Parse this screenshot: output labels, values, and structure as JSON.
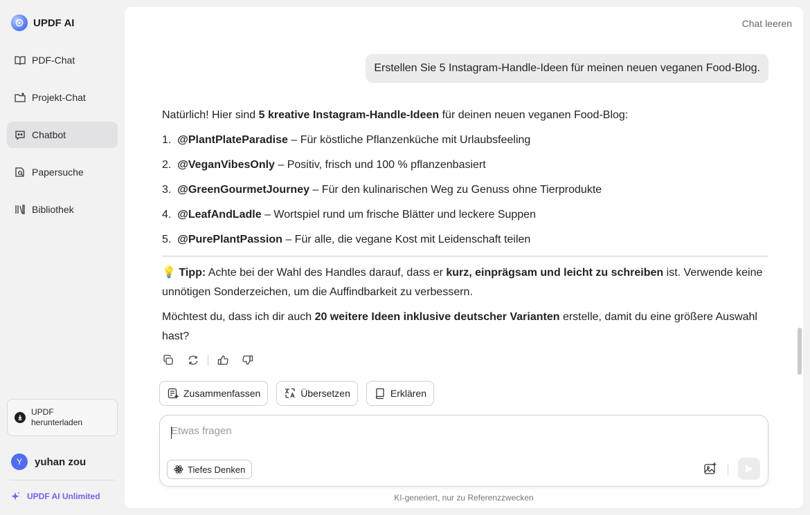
{
  "brand": {
    "name": "UPDF AI"
  },
  "sidebar": {
    "items": [
      {
        "label": "PDF-Chat",
        "icon": "book-open-icon"
      },
      {
        "label": "Projekt-Chat",
        "icon": "folder-plus-icon"
      },
      {
        "label": "Chatbot",
        "icon": "chatbot-icon",
        "active": true
      },
      {
        "label": "Papersuche",
        "icon": "paper-search-icon"
      },
      {
        "label": "Bibliothek",
        "icon": "library-icon"
      }
    ],
    "download": {
      "line1": "UPDF",
      "line2": "herunterladen"
    },
    "user": {
      "initial": "Y",
      "name": "yuhan zou"
    },
    "unlimited": "UPDF AI Unlimited"
  },
  "header": {
    "clear_chat": "Chat leeren"
  },
  "conversation": {
    "user_message": "Erstellen Sie 5 Instagram-Handle-Ideen für meinen neuen veganen Food-Blog.",
    "intro_pre": "Natürlich! Hier sind ",
    "intro_bold": "5 kreative Instagram-Handle-Ideen",
    "intro_post": " für deinen neuen veganen Food-Blog:",
    "list": [
      {
        "num": "1.",
        "handle": "@PlantPlateParadise",
        "desc": " – Für köstliche Pflanzenküche mit Urlaubsfeeling"
      },
      {
        "num": "2.",
        "handle": "@VeganVibesOnly",
        "desc": " – Positiv, frisch und 100 % pflanzenbasiert"
      },
      {
        "num": "3.",
        "handle": "@GreenGourmetJourney",
        "desc": " – Für den kulinarischen Weg zu Genuss ohne Tierprodukte"
      },
      {
        "num": "4.",
        "handle": "@LeafAndLadle",
        "desc": " – Wortspiel rund um frische Blätter und leckere Suppen"
      },
      {
        "num": "5.",
        "handle": "@PurePlantPassion",
        "desc": " – Für alle, die vegane Kost mit Leidenschaft teilen"
      }
    ],
    "tip": {
      "emoji": "💡",
      "label": "Tipp:",
      "pre": " Achte bei der Wahl des Handles darauf, dass er ",
      "bold": "kurz, einprägsam und leicht zu schreiben",
      "post": " ist. Verwende keine unnötigen Sonderzeichen, um die Auffindbarkeit zu verbessern."
    },
    "question": {
      "pre": "Möchtest du, dass ich dir auch ",
      "bold": "20 weitere Ideen inklusive deutscher Varianten",
      "post": " erstelle, damit du eine größere Auswahl hast?"
    }
  },
  "quick_actions": {
    "summarize": "Zusammenfassen",
    "translate": "Übersetzen",
    "explain": "Erklären"
  },
  "composer": {
    "placeholder": "Etwas fragen",
    "deep_thinking": "Tiefes Denken"
  },
  "footnote": "KI-generiert, nur zu Referenzzwecken",
  "colors": {
    "accent": "#7b5cf5",
    "active_nav": "#e2e2e4",
    "brand_blue": "#4f6df2"
  }
}
